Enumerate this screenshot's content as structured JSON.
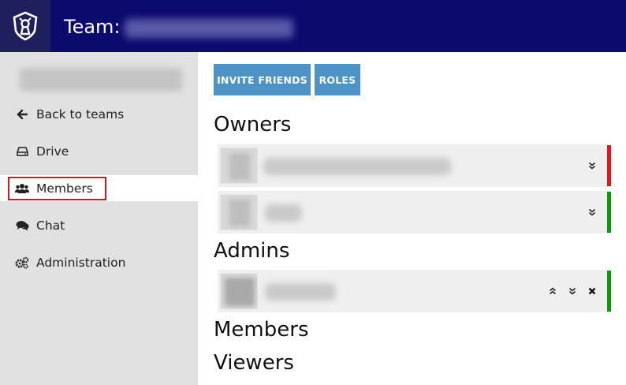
{
  "header": {
    "title_prefix": "Team:",
    "logo_icon": "shield-keyhole-icon",
    "background": "#0b0b6e"
  },
  "sidebar": {
    "items": [
      {
        "label": "Back to teams",
        "icon": "arrow-left-icon"
      },
      {
        "label": "Drive",
        "icon": "hard-drive-icon"
      },
      {
        "label": "Members",
        "icon": "users-icon",
        "active": true
      },
      {
        "label": "Chat",
        "icon": "chat-bubbles-icon"
      },
      {
        "label": "Administration",
        "icon": "gears-icon"
      }
    ]
  },
  "toolbar": {
    "invite_label": "INVITE FRIENDS",
    "roles_label": "ROLES",
    "button_color": "#4d93c6"
  },
  "sections": {
    "owners": "Owners",
    "admins": "Admins",
    "members": "Members",
    "viewers": "Viewers"
  },
  "status_colors": {
    "red": "#e8141b",
    "green": "#0a9a0a"
  }
}
